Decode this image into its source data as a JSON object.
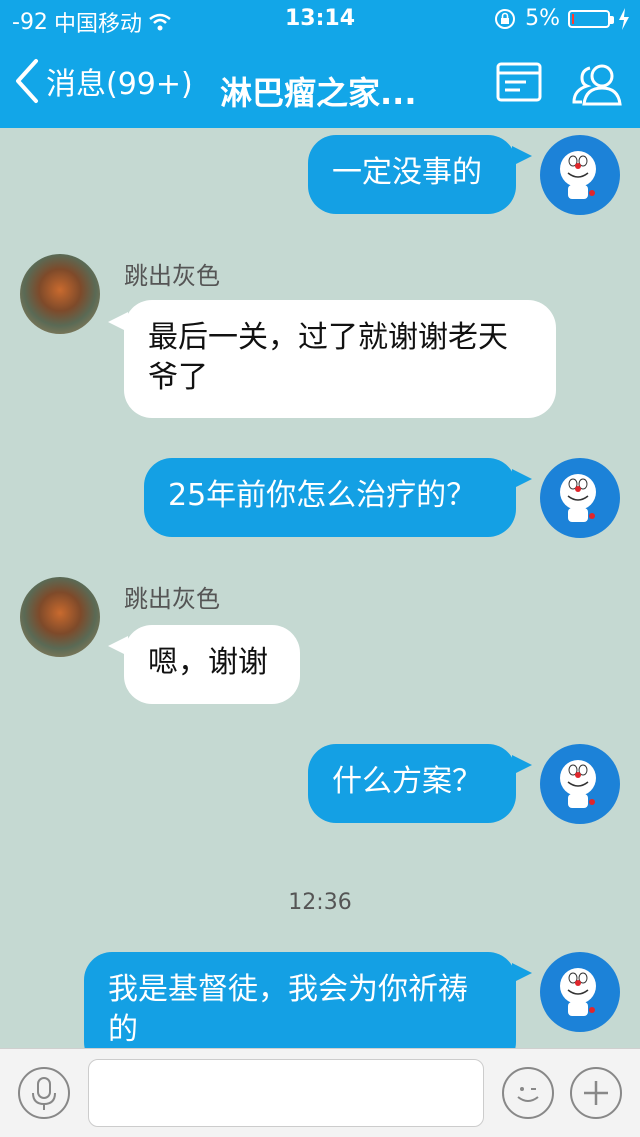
{
  "status_bar": {
    "signal": "-92",
    "carrier": "中国移动",
    "time": "13:14",
    "battery": "5%",
    "battery_level": 0.05
  },
  "nav": {
    "back_label": "消息(99+)",
    "title": "淋巴瘤之家..."
  },
  "messages": [
    {
      "side": "me",
      "text": "一定没事的"
    },
    {
      "side": "other",
      "sender": "跳出灰色",
      "text_line1": "最后一关，过了就谢谢老天",
      "text_line2": "爷了"
    },
    {
      "side": "me",
      "text": "25年前你怎么治疗的？"
    },
    {
      "side": "other",
      "sender": "跳出灰色",
      "text": "嗯，谢谢"
    },
    {
      "side": "me",
      "text": "什么方案？"
    },
    {
      "side": "me",
      "text_line1": "我是基督徒，我会为你祈祷",
      "text_line2": "的"
    }
  ],
  "timestamp": "12:36",
  "colors": {
    "accent": "#12a6e8",
    "bubble_me": "#14a0e4",
    "bubble_other": "#ffffff",
    "chat_bg": "#c5d9d2"
  },
  "icons": {
    "back": "chevron-left-icon",
    "menu": "chat-settings-icon",
    "members": "group-members-icon",
    "voice": "microphone-icon",
    "emoji": "emoji-icon",
    "more": "plus-icon"
  }
}
